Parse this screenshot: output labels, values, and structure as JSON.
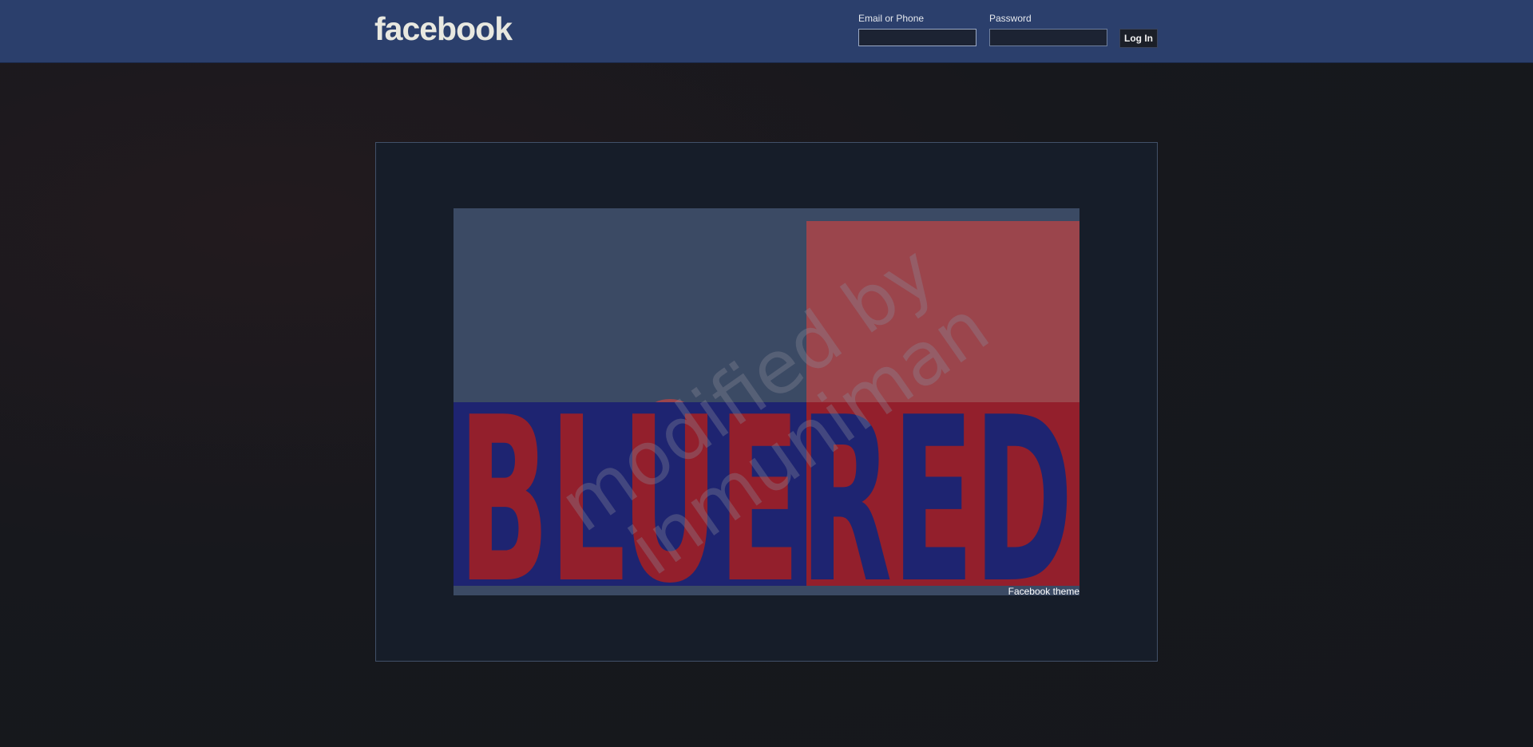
{
  "header": {
    "logo": "facebook",
    "email_label": "Email or Phone",
    "email_value": "",
    "password_label": "Password",
    "password_value": "",
    "login_label": "Log In"
  },
  "main": {
    "image": {
      "top_word": "BLUERED",
      "bottom_word": "BLUERED",
      "watermark_line1": "modified by",
      "watermark_line2": "inmuniman"
    },
    "caption": "Facebook theme"
  },
  "colors": {
    "header_bg": "#2b3f6c",
    "panel_bg": "#161d29",
    "blue": "#1e2471",
    "red": "#931f2c",
    "slate": "#3b4a64",
    "dull_red": "#9b454c"
  }
}
